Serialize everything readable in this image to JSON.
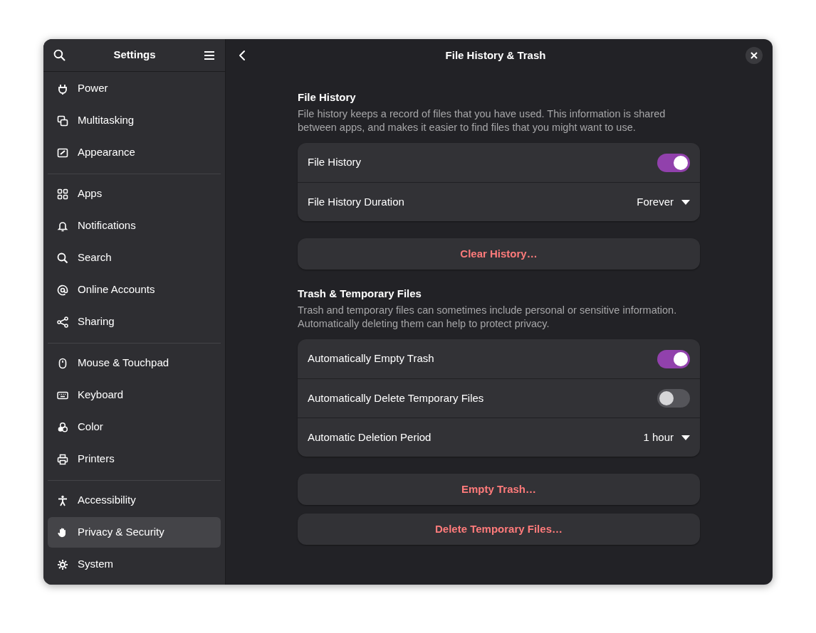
{
  "sidebar": {
    "title": "Settings",
    "sections": [
      {
        "items": [
          {
            "label": "Power",
            "selected": false
          },
          {
            "label": "Multitasking",
            "selected": false
          },
          {
            "label": "Appearance",
            "selected": false
          }
        ]
      },
      {
        "items": [
          {
            "label": "Apps",
            "selected": false
          },
          {
            "label": "Notifications",
            "selected": false
          },
          {
            "label": "Search",
            "selected": false
          },
          {
            "label": "Online Accounts",
            "selected": false
          },
          {
            "label": "Sharing",
            "selected": false
          }
        ]
      },
      {
        "items": [
          {
            "label": "Mouse & Touchpad",
            "selected": false
          },
          {
            "label": "Keyboard",
            "selected": false
          },
          {
            "label": "Color",
            "selected": false
          },
          {
            "label": "Printers",
            "selected": false
          }
        ]
      },
      {
        "items": [
          {
            "label": "Accessibility",
            "selected": false
          },
          {
            "label": "Privacy & Security",
            "selected": true
          },
          {
            "label": "System",
            "selected": false
          }
        ]
      }
    ]
  },
  "page": {
    "title": "File History & Trash",
    "groups": [
      {
        "title": "File History",
        "description": "File history keeps a record of files that you have used. This information is shared between apps, and makes it easier to find files that you might want to use.",
        "rows": [
          {
            "kind": "switch",
            "label": "File History",
            "on": true
          },
          {
            "kind": "dropdown",
            "label": "File History Duration",
            "value": "Forever"
          }
        ],
        "buttons": [
          "Clear History…"
        ]
      },
      {
        "title": "Trash & Temporary Files",
        "description": "Trash and temporary files can sometimes include personal or sensitive information. Automatically deleting them can help to protect privacy.",
        "rows": [
          {
            "kind": "switch",
            "label": "Automatically Empty Trash",
            "on": true
          },
          {
            "kind": "switch",
            "label": "Automatically Delete Temporary Files",
            "on": false
          },
          {
            "kind": "dropdown",
            "label": "Automatic Deletion Period",
            "value": "1 hour"
          }
        ],
        "buttons": [
          "Empty Trash…",
          "Delete Temporary Files…"
        ]
      }
    ]
  }
}
